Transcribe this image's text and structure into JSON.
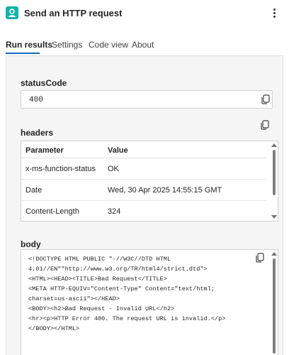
{
  "header": {
    "title": "Send an HTTP request",
    "accent_color": "#13b3a8",
    "app_icon": "action-user-icon",
    "menu_icon": "more-vertical-icon"
  },
  "tabs": [
    {
      "label": "Run results",
      "active": true
    },
    {
      "label": "Settings",
      "active": false
    },
    {
      "label": "Code view",
      "active": false
    },
    {
      "label": "About",
      "active": false
    }
  ],
  "status": {
    "label": "statusCode",
    "value": "400",
    "copy_icon": "copy-icon"
  },
  "headers": {
    "label": "headers",
    "columns": [
      "Parameter",
      "Value"
    ],
    "rows": [
      {
        "parameter": "x-ms-function-status",
        "value": "OK"
      },
      {
        "parameter": "Date",
        "value": "Wed, 30 Apr 2025 14:55:15 GMT"
      },
      {
        "parameter": "Content-Length",
        "value": "324"
      }
    ]
  },
  "body": {
    "label": "body",
    "lines": [
      "<!DOCTYPE HTML PUBLIC \"-//W3C//DTD HTML",
      "4.01//EN\"\"http://www.w3.org/TR/html4/strict.dtd\">",
      "<HTML><HEAD><TITLE>Bad Request</TITLE>",
      "<META HTTP-EQUIV=\"Content-Type\" Content=\"text/html;",
      "charset=us-ascii\"></HEAD>",
      "<BODY><h2>Bad Request - Invalid URL</h2>",
      "<hr><p>HTTP Error 400. The request URL is invalid.</p>",
      "</BODY></HTML>"
    ]
  }
}
